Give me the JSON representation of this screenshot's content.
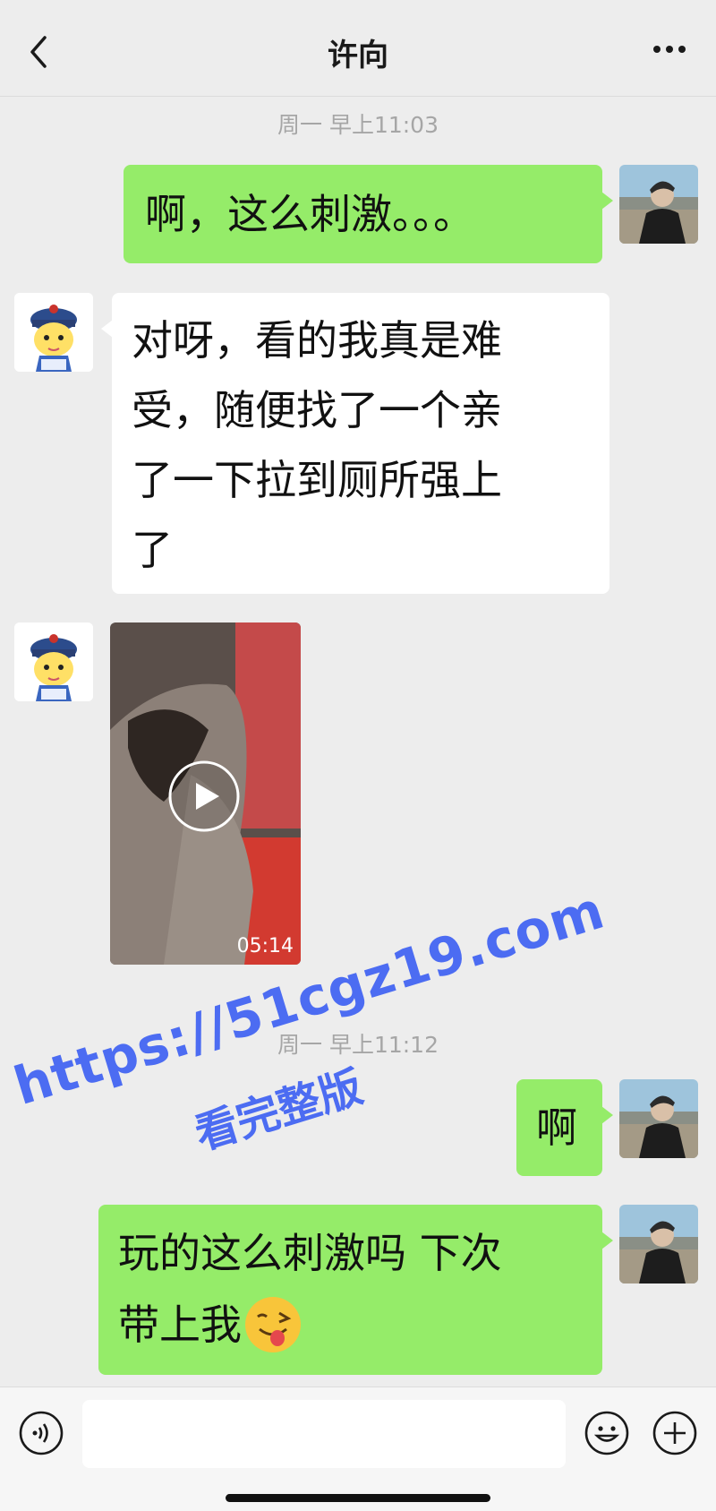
{
  "header": {
    "title": "许向",
    "back_icon": "chevron-left-icon",
    "more_icon": "more-dots-icon"
  },
  "timestamps": [
    "周一 早上11:03",
    "周一 早上11:12"
  ],
  "messages": [
    {
      "side": "right",
      "type": "text",
      "text": "啊，这么刺激。。。"
    },
    {
      "side": "left",
      "type": "text",
      "lines": [
        "对呀，看的我真是难",
        "受，随便找了一个亲",
        "了一下拉到厕所强上",
        "了"
      ]
    },
    {
      "side": "left",
      "type": "video",
      "duration": "05:14"
    },
    {
      "side": "right",
      "type": "text",
      "text": "啊"
    },
    {
      "side": "right",
      "type": "text",
      "lines": [
        "玩的这么刺激吗 下次",
        "带上我"
      ],
      "emoji": "winking-tongue-emoji"
    }
  ],
  "watermark": {
    "line1": "https://51cgz19.com",
    "line2": "看完整版",
    "color": "#4c6cf2"
  },
  "input_bar": {
    "voice_icon": "voice-icon",
    "emoji_icon": "emoji-icon",
    "plus_icon": "plus-icon"
  },
  "colors": {
    "bubble_self": "#95ec69",
    "bubble_other": "#ffffff",
    "background": "#ededed"
  }
}
